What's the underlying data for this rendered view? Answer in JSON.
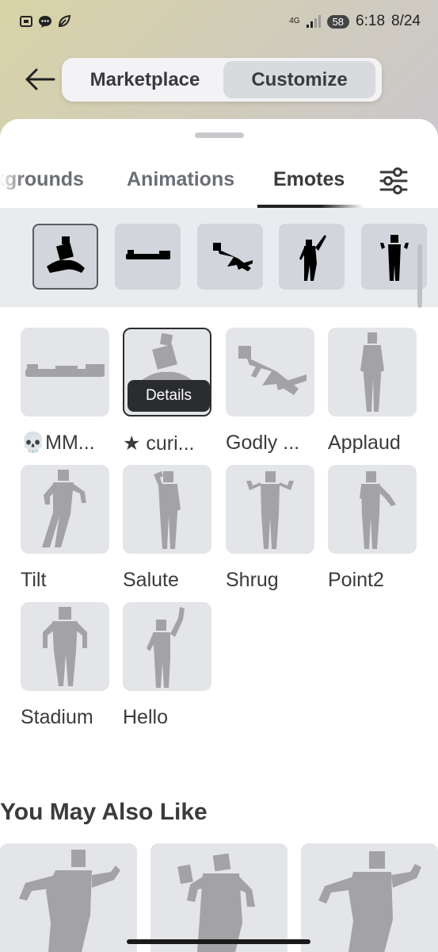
{
  "status_bar": {
    "network": "4G",
    "battery": "58",
    "time": "6:18",
    "date": "8/24"
  },
  "header": {
    "segments": [
      "Marketplace",
      "Customize"
    ],
    "active_segment": "Customize"
  },
  "tabs": {
    "items": [
      "kgrounds",
      "Animations",
      "Emotes"
    ],
    "active": "Emotes"
  },
  "emotes": [
    {
      "label": "💀MM...",
      "icon": "lying-figure"
    },
    {
      "label": "★ curi...",
      "icon": "sitting-figure",
      "details": "Details"
    },
    {
      "label": "Godly ...",
      "icon": "falling-figure"
    },
    {
      "label": "Applaud",
      "icon": "standing-figure"
    },
    {
      "label": "Tilt",
      "icon": "tilt-figure"
    },
    {
      "label": "Salute",
      "icon": "salute-figure"
    },
    {
      "label": "Shrug",
      "icon": "shrug-figure"
    },
    {
      "label": "Point2",
      "icon": "point-figure"
    },
    {
      "label": "Stadium",
      "icon": "stadium-figure"
    },
    {
      "label": "Hello",
      "icon": "wave-figure"
    }
  ],
  "recommendations": {
    "title": "You May Also Like"
  },
  "colors": {
    "accent": "#393b3d",
    "thumb_bg": "#e4e5e8",
    "figure": "#a3a3a6"
  }
}
